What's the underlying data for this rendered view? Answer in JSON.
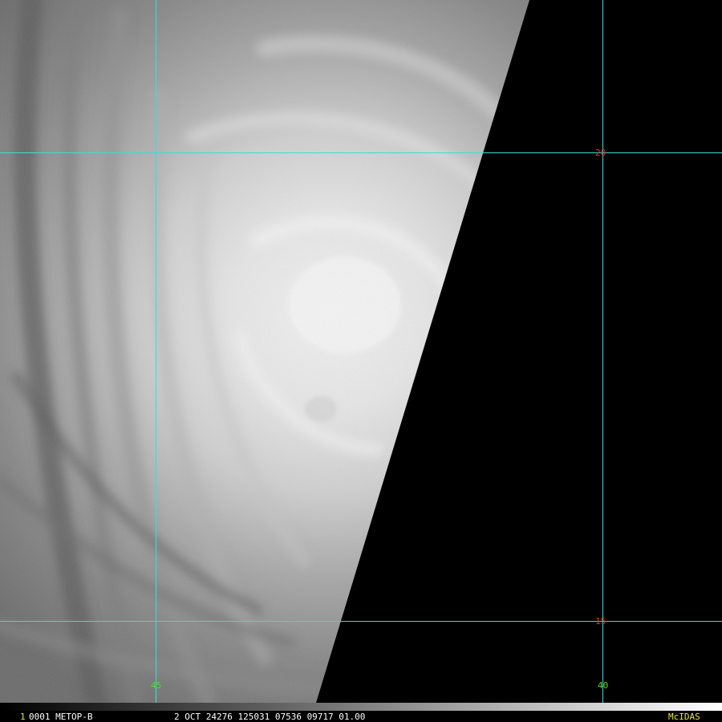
{
  "image": {
    "satellite": "METOP-B",
    "frame_number": "1",
    "frame_id": "0001 METOP-B",
    "datetime_line": "2 OCT 24276 125031 07536 09717 01.00",
    "brand": "McIDAS"
  },
  "grid": {
    "line_color": "#36dede",
    "lat_label_color": "#e03a2a",
    "lon_label_color": "#56d62a",
    "lat_labels": [
      "20",
      "15"
    ],
    "lon_labels": [
      "45",
      "40"
    ]
  },
  "colors": {
    "frame_number": "#e8e820",
    "brand": "#e8e820",
    "status_text": "#ffffff",
    "no_data": "#000000"
  }
}
